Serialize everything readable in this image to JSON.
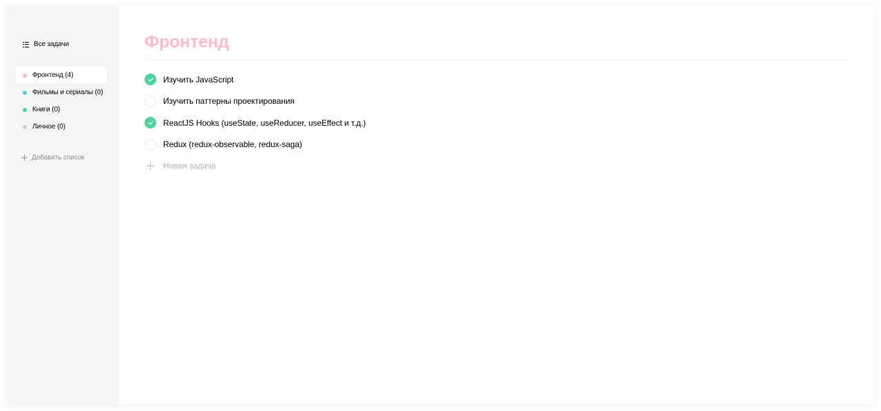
{
  "sidebar": {
    "all_tasks_label": "Все задачи",
    "lists": [
      {
        "label": "Фронтенд (4)",
        "color": "#ffbbcc",
        "active": true
      },
      {
        "label": "Фильмы и сериалы (0)",
        "color": "#64c4ed",
        "active": false
      },
      {
        "label": "Книги (0)",
        "color": "#4dd599",
        "active": false
      },
      {
        "label": "Личное (0)",
        "color": "#c9d1d3",
        "active": false
      }
    ],
    "add_list_label": "Добавить список"
  },
  "main": {
    "title": "Фронтенд",
    "title_color": "#ffbbcc",
    "tasks": [
      {
        "text": "Изучить JavaScript",
        "done": true
      },
      {
        "text": "Изучить паттерны проектирования",
        "done": false
      },
      {
        "text": "ReactJS Hooks (useState, useReducer, useEffect и т.д.)",
        "done": true
      },
      {
        "text": "Redux (redux-observable, redux-saga)",
        "done": false
      }
    ],
    "new_task_placeholder": "Новая задача"
  },
  "colors": {
    "check_done": "#4dd599",
    "sidebar_bg": "#f4f6f8"
  }
}
